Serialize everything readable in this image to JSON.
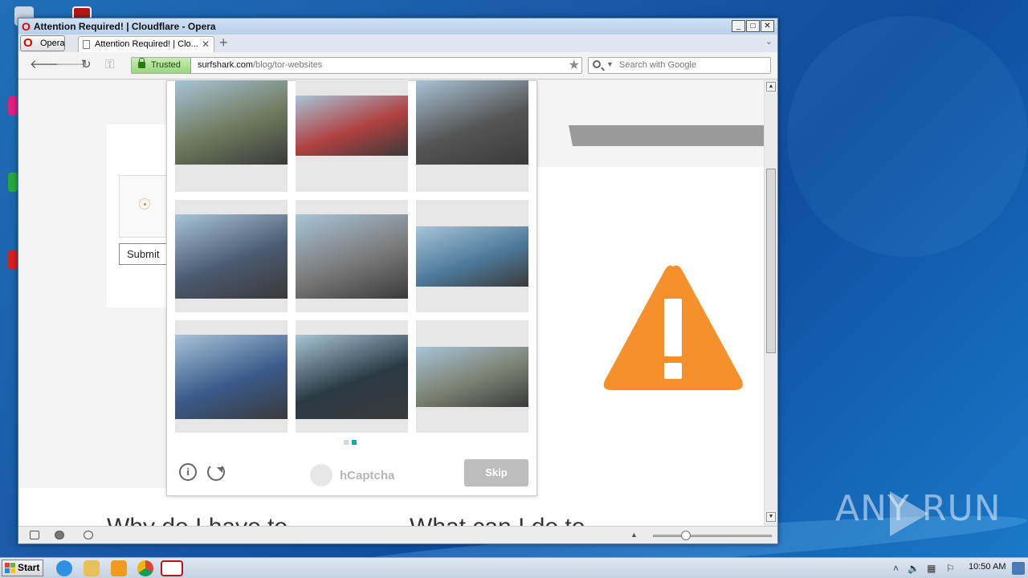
{
  "window": {
    "title": "Attention Required! | Cloudflare - Opera",
    "controls": {
      "minimize": "_",
      "maximize": "□",
      "close": "✕"
    }
  },
  "browser": {
    "menu_label": "Opera",
    "tab": {
      "title": "Attention Required! | Clo...",
      "close": "✕"
    },
    "new_tab": "+",
    "address": {
      "security": "Trusted",
      "domain": "surfshark.com",
      "path": "/blog/tor-websites"
    },
    "search_placeholder": "Search with Google"
  },
  "page": {
    "submit_label": "Submit",
    "heading_left": "Why do I have to",
    "heading_right": "What can I do to"
  },
  "captcha": {
    "tiles": [
      {
        "icon": "dump-truck-image",
        "tone": "#6e7a5c"
      },
      {
        "icon": "fire-truck-image",
        "tone": "#b04040"
      },
      {
        "icon": "bicycle-shop-image",
        "tone": "#555555"
      },
      {
        "icon": "roll-off-truck-image",
        "tone": "#4a5a70"
      },
      {
        "icon": "motorcycle-wheel-image",
        "tone": "#7a7a7a"
      },
      {
        "icon": "car-carrier-truck-image",
        "tone": "#4d7a9a"
      },
      {
        "icon": "semi-truck-image",
        "tone": "#3a5a8a"
      },
      {
        "icon": "white-car-image",
        "tone": "#2a3a44"
      },
      {
        "icon": "street-truck-image",
        "tone": "#7a8070"
      }
    ],
    "page_dots": 2,
    "active_dot": 1,
    "info_label": "i",
    "brand": "hCaptcha",
    "skip_label": "Skip"
  },
  "taskbar": {
    "start_label": "Start",
    "clock": "10:50 AM",
    "apps": [
      "ie-icon",
      "explorer-icon",
      "media-player-icon",
      "chrome-icon",
      "opera-icon"
    ]
  },
  "watermark": "ANY RUN",
  "colors": {
    "warning": "#f6902a",
    "trusted_green": "#9bd57e",
    "skip": "#bdbdbd",
    "dot_active": "#1aa5b0"
  }
}
